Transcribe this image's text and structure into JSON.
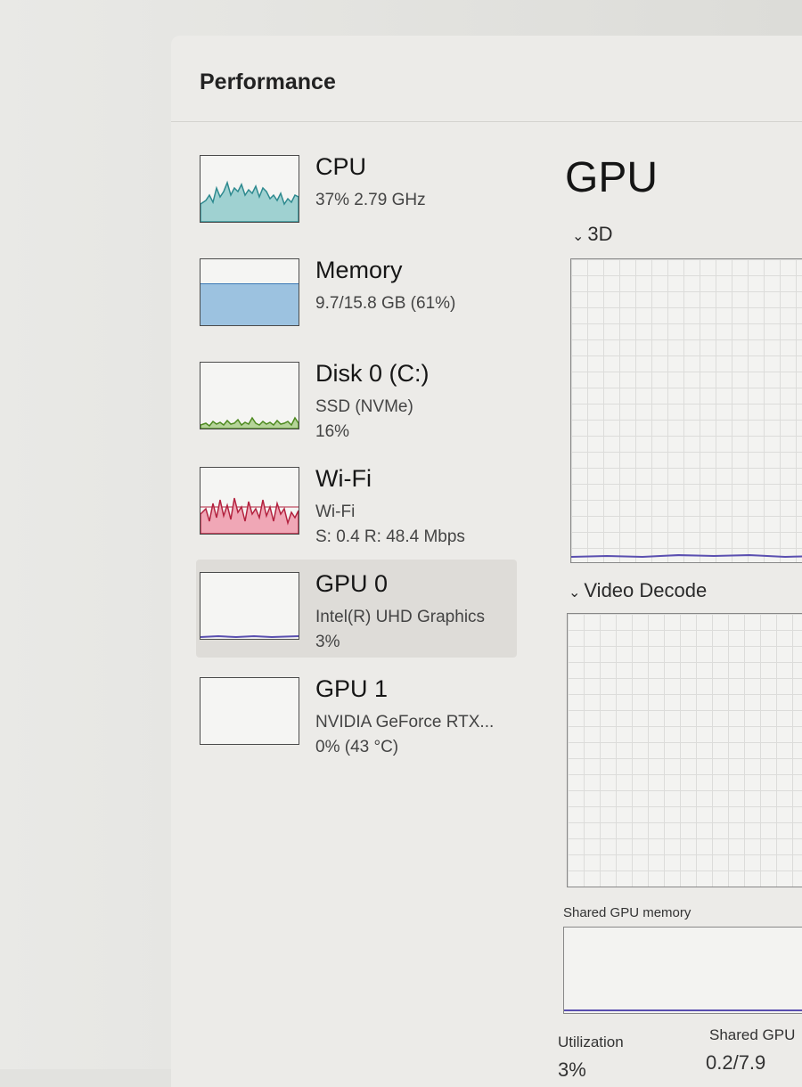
{
  "window": {
    "title": "Performance"
  },
  "sidebar": {
    "items": [
      {
        "title": "CPU",
        "sub1": "37% 2.79 GHz",
        "sub2": "",
        "color": "#2e8a8f",
        "fill": "#9fd1d1"
      },
      {
        "title": "Memory",
        "sub1": "9.7/15.8 GB (61%)",
        "sub2": "",
        "color": "#3a79b6",
        "fill": "#9cc2e0"
      },
      {
        "title": "Disk 0 (C:)",
        "sub1": "SSD (NVMe)",
        "sub2": "16%",
        "color": "#4d8a1f",
        "fill": "#b6d49a"
      },
      {
        "title": "Wi-Fi",
        "sub1": "Wi-Fi",
        "sub2": "S: 0.4 R: 48.4 Mbps",
        "color": "#b3223f",
        "fill": "#f0a7b6"
      },
      {
        "title": "GPU 0",
        "sub1": "Intel(R) UHD Graphics",
        "sub2": "3%",
        "color": "#5a4fb0",
        "fill": "#c9c4ec",
        "selected": true
      },
      {
        "title": "GPU 1",
        "sub1": "NVIDIA GeForce RTX...",
        "sub2": "0% (43 °C)",
        "color": "#5a4fb0",
        "fill": "#c9c4ec"
      }
    ]
  },
  "main": {
    "title": "GPU",
    "sections": {
      "engine1": "3D",
      "engine2": "Video Decode"
    },
    "shared_memory_label": "Shared GPU memory",
    "utilization_label": "Utilization",
    "utilization_value": "3%",
    "shared_gpu_label": "Shared GPU",
    "shared_gpu_value": "0.2/7.9"
  },
  "icons": {
    "chevron": "chevron-down-icon"
  }
}
